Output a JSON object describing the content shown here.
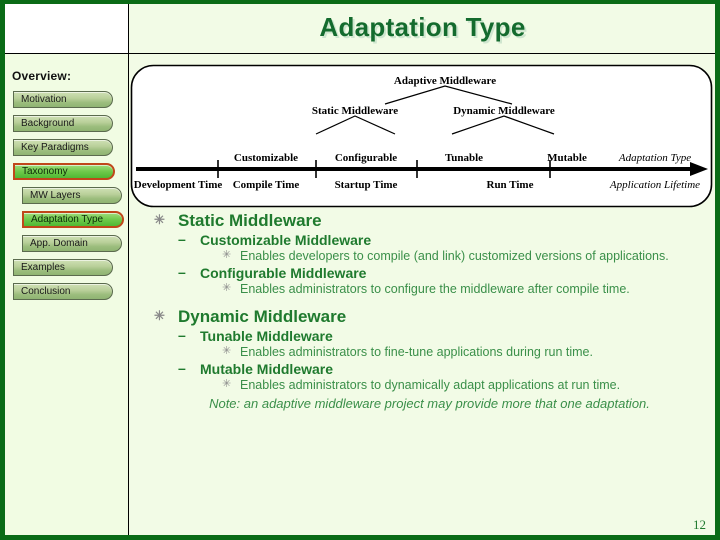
{
  "slide": {
    "title": "Adaptation Type",
    "page_number": "12",
    "accent_green": "#146b2e",
    "body_green": "#1f7a2e",
    "sub_green": "#3a8f49",
    "highlight_border": "#c0471a"
  },
  "sidebar": {
    "heading": "Overview:",
    "items": [
      {
        "label": "Motivation",
        "level": 1,
        "selected": false
      },
      {
        "label": "Background",
        "level": 1,
        "selected": false
      },
      {
        "label": "Key Paradigms",
        "level": 1,
        "selected": false
      },
      {
        "label": "Taxonomy",
        "level": 1,
        "selected": true
      },
      {
        "label": "MW Layers",
        "level": 2,
        "selected": false
      },
      {
        "label": "Adaptation Type",
        "level": 2,
        "selected": true
      },
      {
        "label": "App. Domain",
        "level": 2,
        "selected": false
      },
      {
        "label": "Examples",
        "level": 1,
        "selected": false
      },
      {
        "label": "Conclusion",
        "level": 1,
        "selected": false
      }
    ]
  },
  "diagram": {
    "root": "Adaptive Middleware",
    "branches": [
      "Static Middleware",
      "Dynamic Middleware"
    ],
    "leaves": [
      "Customizable",
      "Configurable",
      "Tunable",
      "Mutable"
    ],
    "axis_row_label": "Adaptation Type",
    "timeline_label": "Application Lifetime",
    "phases": [
      "Development Time",
      "Compile Time",
      "Startup Time",
      "Run Time"
    ]
  },
  "body": {
    "sections": [
      {
        "title": "Static Middleware",
        "subs": [
          {
            "title": "Customizable Middleware",
            "detail": "Enables developers to compile (and link) customized versions of applications."
          },
          {
            "title": "Configurable Middleware",
            "detail": "Enables administrators to configure the middleware after compile time."
          }
        ]
      },
      {
        "title": "Dynamic Middleware",
        "subs": [
          {
            "title": "Tunable Middleware",
            "detail": "Enables administrators to fine-tune applications during run time."
          },
          {
            "title": "Mutable Middleware",
            "detail": "Enables administrators to dynamically adapt applications at run time."
          }
        ]
      }
    ],
    "note": "Note: an adaptive middleware project may provide more that one adaptation.",
    "bullet_level1": "✳",
    "bullet_level2": "–",
    "bullet_level3": "✳"
  }
}
